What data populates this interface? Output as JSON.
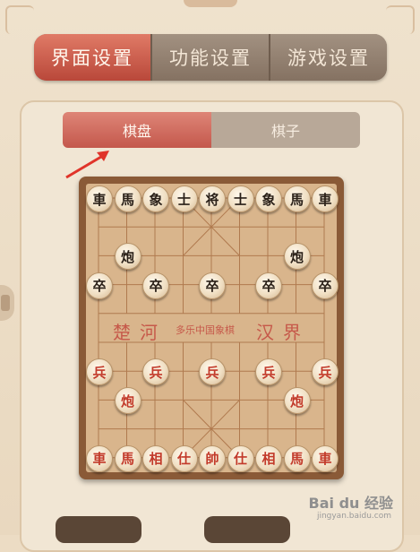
{
  "main_tabs": [
    {
      "label": "界面设置",
      "active": true
    },
    {
      "label": "功能设置",
      "active": false
    },
    {
      "label": "游戏设置",
      "active": false
    }
  ],
  "sub_tabs": [
    {
      "label": "棋盘",
      "active": true
    },
    {
      "label": "棋子",
      "active": false
    }
  ],
  "board": {
    "river_left": "楚河",
    "river_right": "汉界",
    "river_center": "多乐中国象棋",
    "black_back_row": [
      "車",
      "馬",
      "象",
      "士",
      "将",
      "士",
      "象",
      "馬",
      "車"
    ],
    "black_cannon": "炮",
    "black_soldier": "卒",
    "red_back_row": [
      "車",
      "馬",
      "相",
      "仕",
      "帥",
      "仕",
      "相",
      "馬",
      "車"
    ],
    "red_cannon": "炮",
    "red_soldier": "兵"
  },
  "watermark": {
    "brand": "Bai du 经验",
    "url": "jingyan.baidu.com"
  },
  "colors": {
    "accent": "#c4584c",
    "board": "#d9b58c",
    "board_frame": "#8a5a37",
    "red_piece_text": "#c23a2a"
  }
}
